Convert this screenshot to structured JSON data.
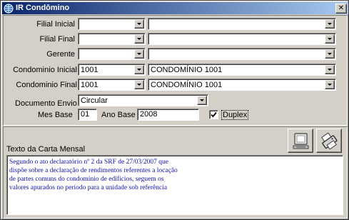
{
  "window": {
    "title": "IR Condômino",
    "icon": "app-globe-icon"
  },
  "filters": {
    "filial_inicial": {
      "label": "Filial Inicial",
      "code": "",
      "name": ""
    },
    "filial_final": {
      "label": "Filial Final",
      "code": "",
      "name": ""
    },
    "gerente": {
      "label": "Gerente",
      "code": "",
      "name": ""
    },
    "condominio_inicial": {
      "label": "Condominio Inicial",
      "code": "1001",
      "name": "CONDOMÍNIO 1001"
    },
    "condominio_final": {
      "label": "Condominio Final",
      "code": "1001",
      "name": "CONDOMÍNIO 1001"
    }
  },
  "documento": {
    "label": "Documento Envio",
    "value": "Circular"
  },
  "mes_base": {
    "label": "Mes Base",
    "value": "01"
  },
  "ano_base": {
    "label": "Ano Base",
    "value": "2008"
  },
  "duplex": {
    "label": "Duplex",
    "checked": true
  },
  "carta": {
    "label": "Texto da Carta Mensal",
    "lines": [
      "Segundo o ato declaratório nº 2 da SRF de 27/03/2007 que",
      "dispõe sobre a declaração de rendimentos referentes a locação",
      "de partes comuns do condomínio de edifícios, seguem os",
      "valores apurados no período para a unidade sob referência"
    ],
    "text_color": "#1010b0"
  },
  "toolbar": {
    "preview_icon": "monitor-icon",
    "print_icon": "printer-icon"
  },
  "colors": {
    "window_bg": "#d4d0c8",
    "title_from": "#0a246a",
    "title_to": "#a6caf0"
  }
}
